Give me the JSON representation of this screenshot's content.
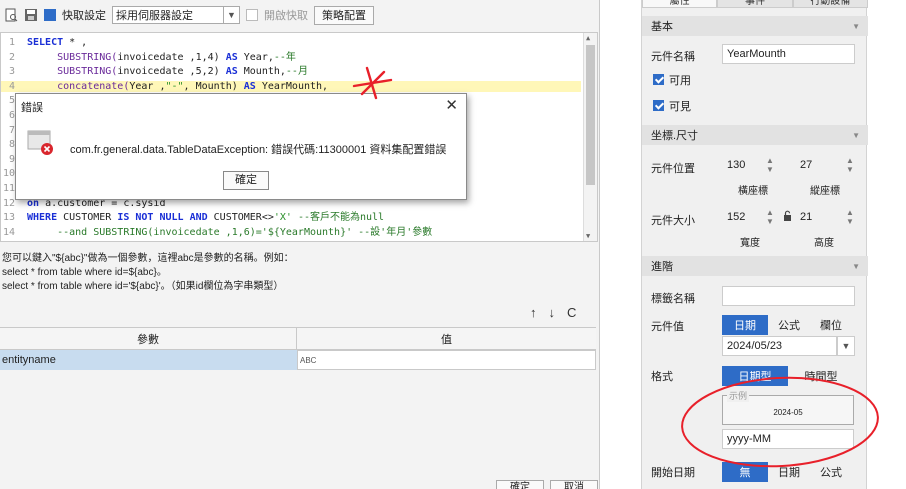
{
  "toolbar": {
    "cache_checkbox_label": "快取設定",
    "cache_select_value": "採用伺服器設定",
    "enable_cache_label": "開啟快取",
    "strategy_button": "策略配置"
  },
  "editor": {
    "lines": [
      {
        "n": "1",
        "parts": [
          {
            "t": "SELECT",
            "c": "kw"
          },
          {
            "t": " * ,",
            "c": ""
          }
        ]
      },
      {
        "n": "2",
        "parts": [
          {
            "t": "     SUBSTRING(",
            "c": "fn"
          },
          {
            "t": "invoicedate ,1,4) ",
            "c": ""
          },
          {
            "t": "AS",
            "c": "kw"
          },
          {
            "t": " Year,",
            "c": ""
          },
          {
            "t": "--年",
            "c": "cmt"
          }
        ]
      },
      {
        "n": "3",
        "parts": [
          {
            "t": "     SUBSTRING(",
            "c": "fn"
          },
          {
            "t": "invoicedate ,5,2) ",
            "c": ""
          },
          {
            "t": "AS",
            "c": "kw"
          },
          {
            "t": " Mounth,",
            "c": ""
          },
          {
            "t": "--月",
            "c": "cmt"
          }
        ]
      },
      {
        "n": "4",
        "parts": [
          {
            "t": "     concatenate(",
            "c": "fn"
          },
          {
            "t": "Year ,",
            "c": ""
          },
          {
            "t": "\"-\"",
            "c": "str"
          },
          {
            "t": ", Mounth) ",
            "c": ""
          },
          {
            "t": "AS",
            "c": "kw"
          },
          {
            "t": " YearMounth,",
            "c": ""
          }
        ]
      },
      {
        "n": "5",
        "parts": []
      },
      {
        "n": "6",
        "parts": []
      },
      {
        "n": "7",
        "parts": []
      },
      {
        "n": "8",
        "parts": []
      },
      {
        "n": "9",
        "parts": []
      },
      {
        "n": "10",
        "parts": []
      },
      {
        "n": "11",
        "parts": []
      },
      {
        "n": "12",
        "parts": [
          {
            "t": "on",
            "c": "kw"
          },
          {
            "t": " a.customer = c.sysid",
            "c": ""
          }
        ]
      },
      {
        "n": "13",
        "parts": [
          {
            "t": "WHERE",
            "c": "kw"
          },
          {
            "t": " CUSTOMER ",
            "c": ""
          },
          {
            "t": "IS NOT NULL AND",
            "c": "kw"
          },
          {
            "t": " CUSTOMER<>",
            "c": ""
          },
          {
            "t": "'X'",
            "c": "str"
          },
          {
            "t": " --客戶不能為null",
            "c": "cmt"
          }
        ]
      },
      {
        "n": "14",
        "parts": [
          {
            "t": "     --and SUBSTRING(invoicedate ,1,6)='${YearMounth}' --設'年月'參數",
            "c": "cmt"
          }
        ]
      }
    ]
  },
  "hint": {
    "line1": "您可以鍵入\"${abc}\"做為一個參數，這裡abc是參數的名稱。例如：",
    "line2": "select * from table where id=${abc}。",
    "line3": "select * from table where id='${abc}'。（如果id欄位為字串類型）"
  },
  "param_table": {
    "col_param": "參數",
    "col_value": "值",
    "row_name": "entityname",
    "row_value_icon": "ABC"
  },
  "param_tools": {
    "up": "↑",
    "down": "↓",
    "refresh": "C"
  },
  "bottom_buttons": {
    "ok": "確定",
    "cancel": "取消"
  },
  "error_dialog": {
    "title": "錯誤",
    "message": "com.fr.general.data.TableDataException: 錯誤代碼:11300001 資料集配置錯誤",
    "ok": "確定",
    "close": "✕"
  },
  "properties": {
    "tabs": [
      "屬性",
      "事件",
      "行動設備"
    ],
    "basic_section": "基本",
    "widget_name_label": "元件名稱",
    "widget_name_value": "YearMounth",
    "enabled_label": "可用",
    "visible_label": "可見",
    "coord_section": "坐標.尺寸",
    "position_label": "元件位置",
    "pos_x": "130",
    "pos_y": "27",
    "pos_x_label": "橫座標",
    "pos_y_label": "縱座標",
    "size_label": "元件大小",
    "width": "152",
    "height": "21",
    "width_label": "寬度",
    "height_label": "高度",
    "advanced_section": "進階",
    "tag_name_label": "標籤名稱",
    "tag_name_value": "",
    "widget_value_label": "元件值",
    "value_types": [
      "日期",
      "公式",
      "欄位"
    ],
    "date_value": "2024/05/23",
    "format_label": "格式",
    "format_types": [
      "日期型",
      "時間型"
    ],
    "example_legend": "示例",
    "example_value": "2024-05",
    "format_value": "yyyy-MM",
    "start_date_label": "開始日期",
    "start_date_types": [
      "無",
      "日期",
      "公式"
    ]
  },
  "colors": {
    "accent": "#2e6cc7",
    "annotation": "#e8202a"
  }
}
